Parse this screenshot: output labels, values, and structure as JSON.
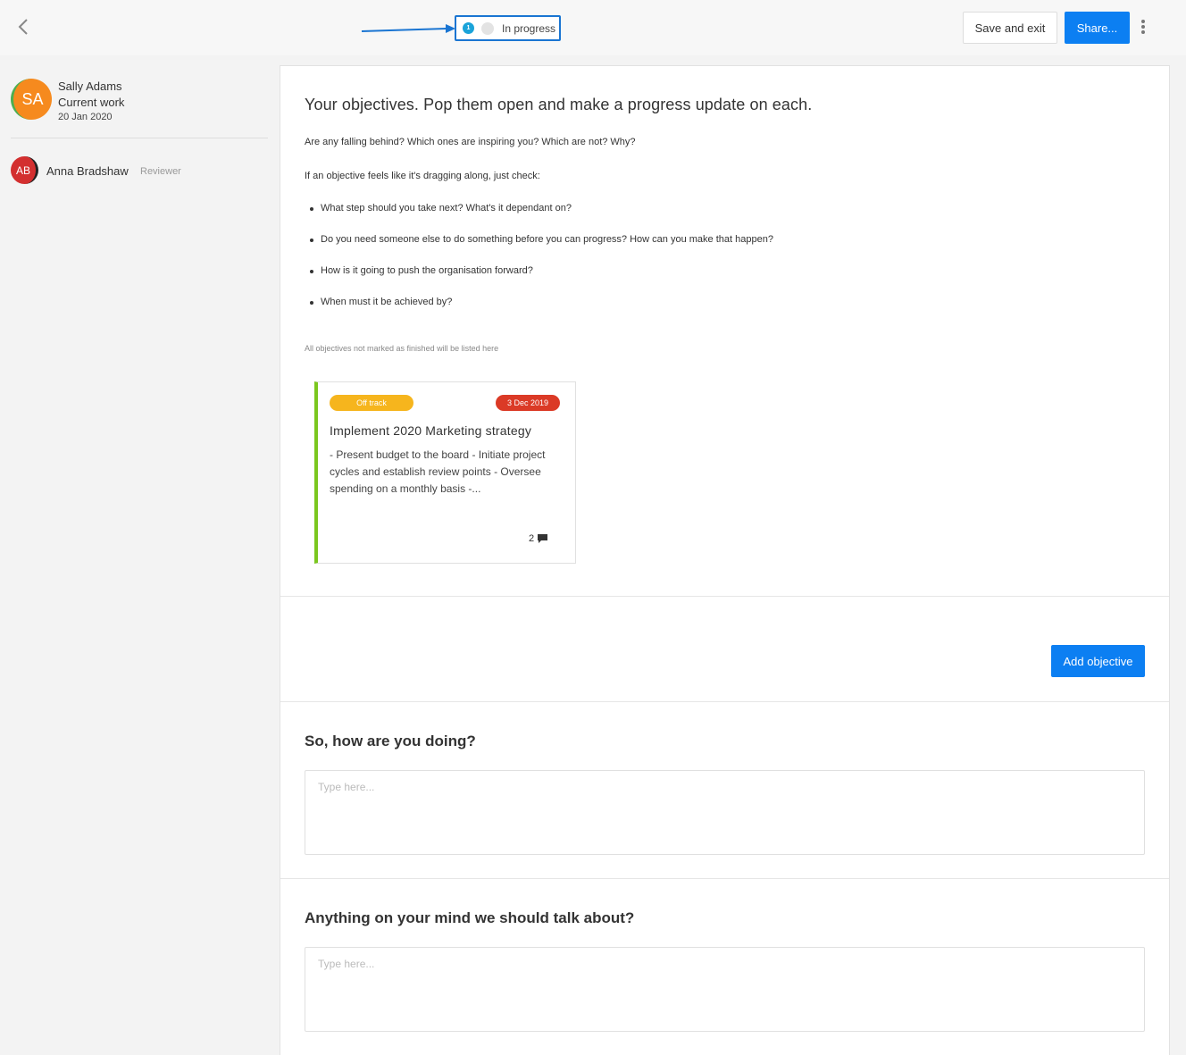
{
  "topbar": {
    "status": {
      "step_number": "1",
      "label": "In progress"
    },
    "save_exit_label": "Save and exit",
    "share_label": "Share..."
  },
  "sidebar": {
    "owner": {
      "initials": "SA",
      "name": "Sally Adams",
      "subtitle": "Current work",
      "date": "20 Jan 2020"
    },
    "reviewer": {
      "initials": "AB",
      "name": "Anna Bradshaw",
      "role": "Reviewer"
    }
  },
  "objectives": {
    "heading": "Your objectives. Pop them open and make a progress update on each.",
    "para1": "Are any falling behind?  Which ones are inspiring you? Which are not? Why?",
    "para2": "If an objective feels like it's dragging along, just check:",
    "bullets": [
      "What step should you take next? What's it dependant on?",
      "Do you need someone else to do something before you can progress? How can you make that happen?",
      "How is it going to push the organisation forward?",
      "When must it be achieved by?"
    ],
    "note": "All objectives not marked as finished will be listed here",
    "card": {
      "status": "Off track",
      "due_date": "3 Dec 2019",
      "title": "Implement 2020 Marketing strategy",
      "description": "- Present budget to the board - Initiate project cycles and establish review points - Oversee spending on a monthly basis -...",
      "comment_count": "2"
    },
    "add_label": "Add objective"
  },
  "questions": [
    {
      "title": "So, how are you doing?",
      "placeholder": "Type here..."
    },
    {
      "title": "Anything on your mind we should talk about?",
      "placeholder": "Type here..."
    }
  ],
  "colors": {
    "primary": "#0c7ff2",
    "off_track": "#f6b51d",
    "overdue": "#db3a26",
    "card_accent": "#7bc71e",
    "annotation": "#1a75d2"
  }
}
